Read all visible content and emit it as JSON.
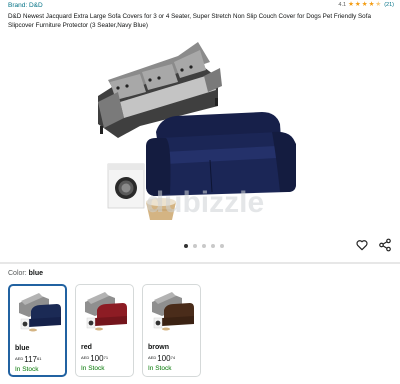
{
  "product": {
    "brand_link": "Brand: D&D",
    "title": "D&D Newest Jacquard Extra Large Sofa Covers for 3 or 4 Seater, Super Stretch Non Slip Couch Cover for Dogs Pet Friendly Sofa Slipcover Furniture Protector (3 Seater,Navy Blue)",
    "rating_value": "4.1",
    "rating_stars": 4.1,
    "rating_count": "(21)"
  },
  "gallery": {
    "watermark": "dubizzle",
    "image_count": 5,
    "active_index": 0
  },
  "actions": {
    "wishlist_icon": "heart-icon",
    "share_icon": "share-icon"
  },
  "variant": {
    "label": "Color:",
    "selected": "blue",
    "options": [
      {
        "name": "blue",
        "currency": "AED",
        "price_whole": "117",
        "price_fraction": "61",
        "stock": "In Stock",
        "swatch": "#1b2a55",
        "selected": true
      },
      {
        "name": "red",
        "currency": "AED",
        "price_whole": "100",
        "price_fraction": "71",
        "stock": "In Stock",
        "swatch": "#8d1c24",
        "selected": false
      },
      {
        "name": "brown",
        "currency": "AED",
        "price_whole": "100",
        "price_fraction": "74",
        "stock": "In Stock",
        "swatch": "#4a2c1a",
        "selected": false
      }
    ]
  },
  "colors": {
    "link": "#007185",
    "stock": "#007600",
    "selected_border": "#2162a1",
    "star": "#f39c12"
  }
}
